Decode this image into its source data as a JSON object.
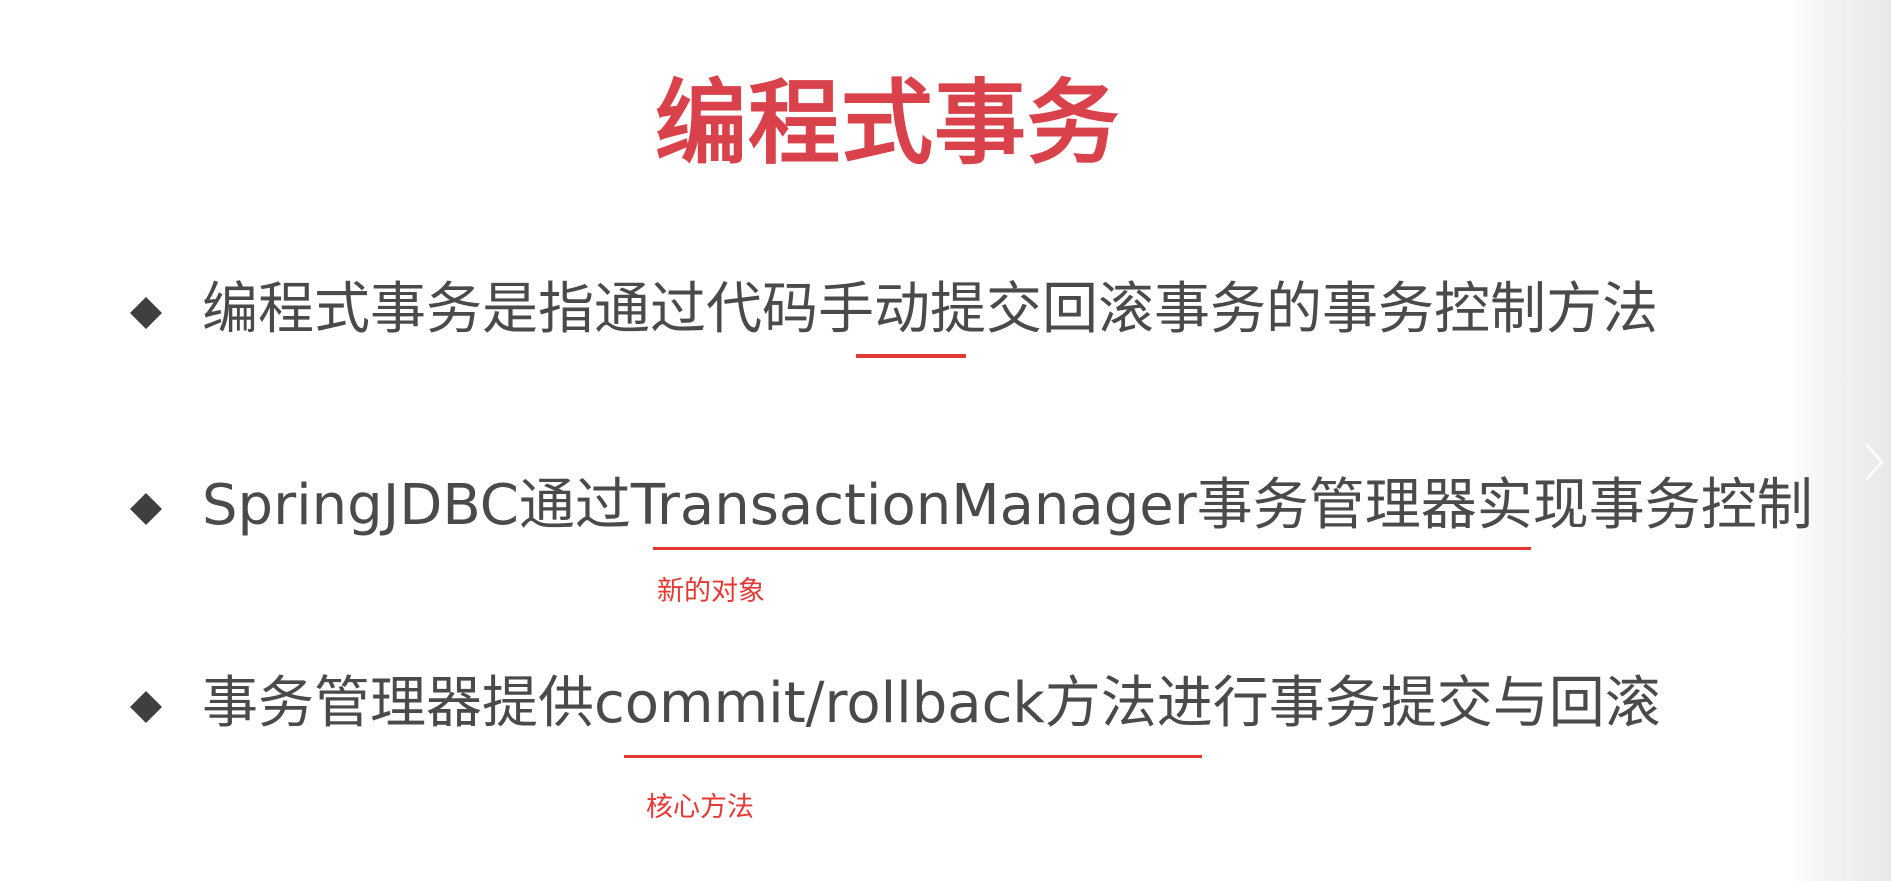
{
  "slide": {
    "title": "编程式事务",
    "bullets": [
      {
        "text": "编程式事务是指通过代码手动提交回滚事务的事务控制方法"
      },
      {
        "text": "SpringJDBC通过TransactionManager事务管理器实现事务控制"
      },
      {
        "text": "事务管理器提供commit/rollback方法进行事务提交与回滚"
      }
    ],
    "annotations": [
      {
        "text": "新的对象"
      },
      {
        "text": "核心方法"
      }
    ]
  },
  "colors": {
    "title": "#d9424a",
    "body_text": "#4a4a4a",
    "annotation": "#e53935",
    "bullet_marker": "#3f3f3f"
  },
  "icons": {
    "bullet": "diamond-bullet-icon",
    "next": "chevron-right-icon"
  }
}
